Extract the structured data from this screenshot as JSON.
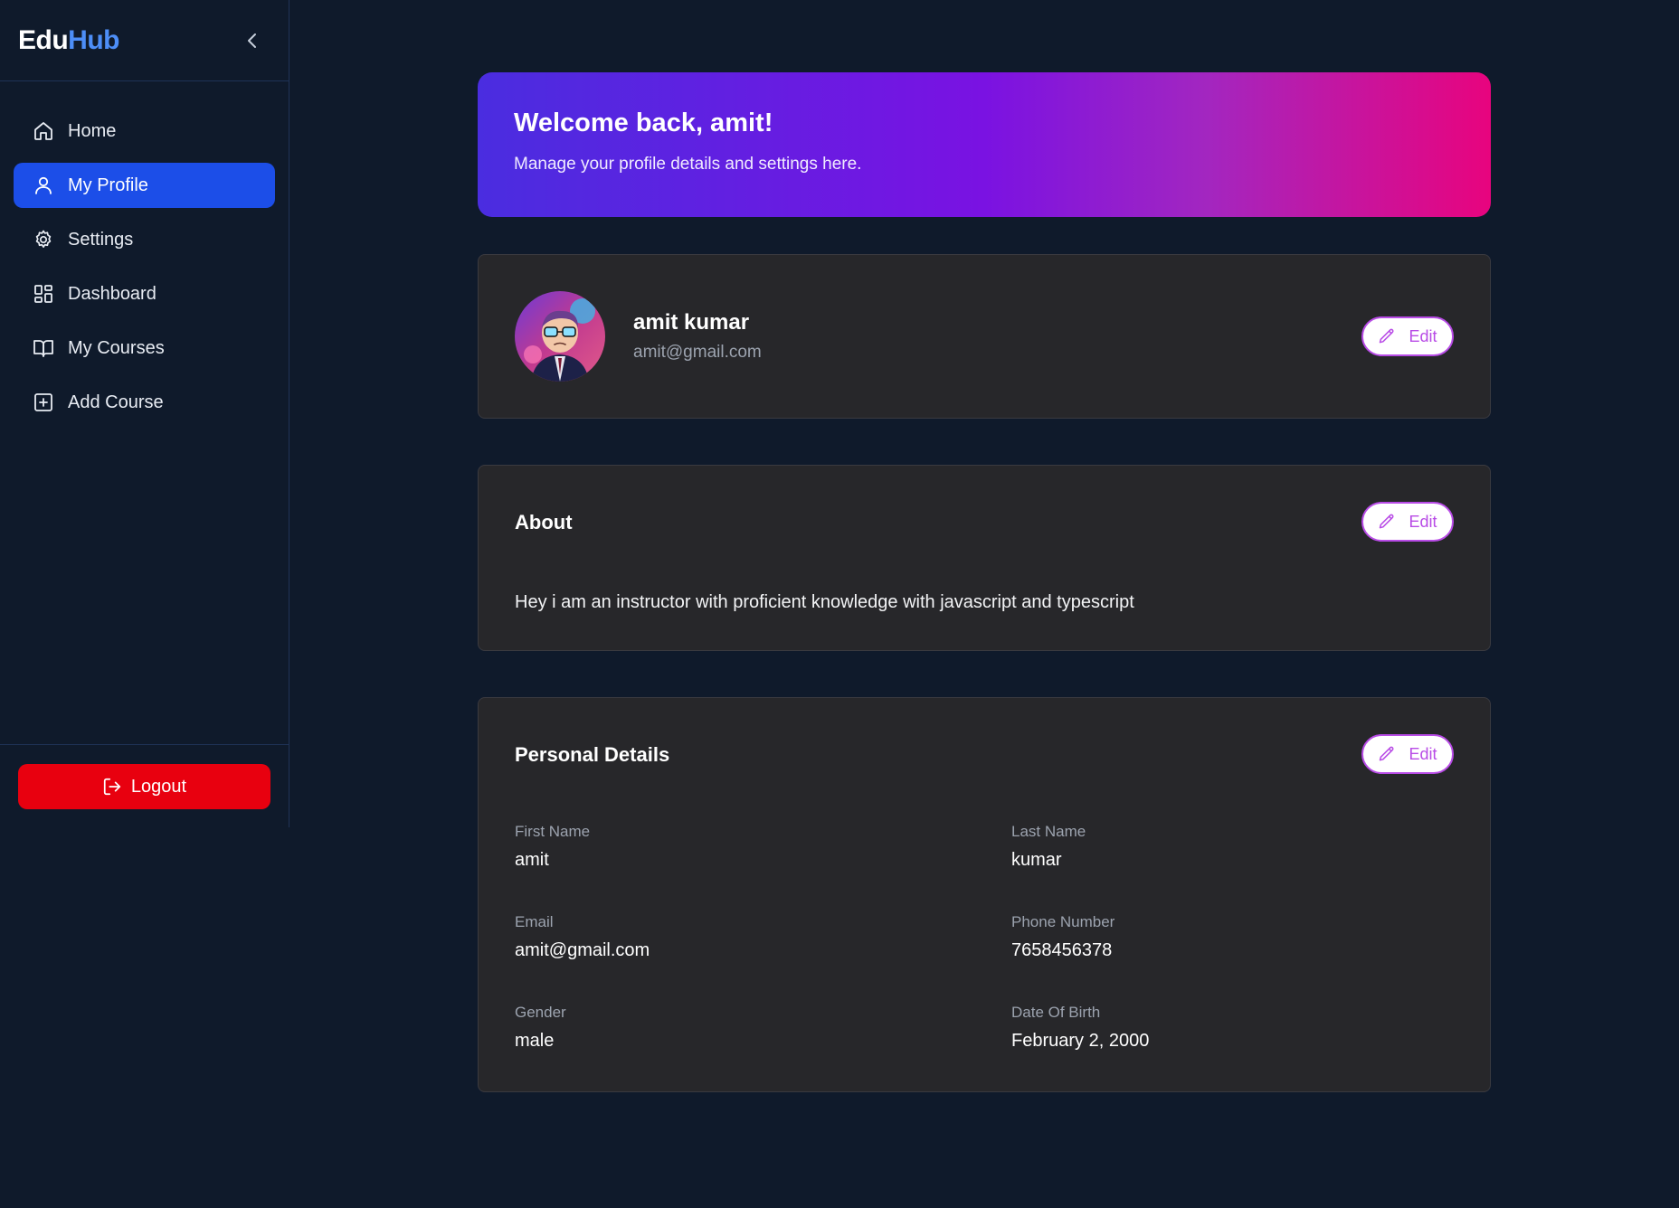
{
  "sidebar": {
    "logo_part1": "Edu",
    "logo_part2": "Hub",
    "items": [
      {
        "label": "Home",
        "icon": "home-icon",
        "active": false
      },
      {
        "label": "My Profile",
        "icon": "user-icon",
        "active": true
      },
      {
        "label": "Settings",
        "icon": "gear-icon",
        "active": false
      },
      {
        "label": "Dashboard",
        "icon": "dashboard-icon",
        "active": false
      },
      {
        "label": "My Courses",
        "icon": "book-icon",
        "active": false
      },
      {
        "label": "Add Course",
        "icon": "plus-square-icon",
        "active": false
      }
    ],
    "logout_label": "Logout"
  },
  "banner": {
    "title": "Welcome back, amit!",
    "subtitle": "Manage your profile details and settings here."
  },
  "profile": {
    "name": "amit kumar",
    "email": "amit@gmail.com",
    "edit_label": "Edit"
  },
  "about": {
    "title": "About",
    "text": "Hey i am an instructor with proficient knowledge with javascript and typescript",
    "edit_label": "Edit"
  },
  "personal_details": {
    "title": "Personal Details",
    "edit_label": "Edit",
    "fields": [
      {
        "label": "First Name",
        "value": "amit"
      },
      {
        "label": "Last Name",
        "value": "kumar"
      },
      {
        "label": "Email",
        "value": "amit@gmail.com"
      },
      {
        "label": "Phone Number",
        "value": "7658456378"
      },
      {
        "label": "Gender",
        "value": "male"
      },
      {
        "label": "Date Of Birth",
        "value": "February 2, 2000"
      }
    ]
  },
  "colors": {
    "background": "#0f1a2b",
    "active_nav": "#1c4ee8",
    "logout": "#e8000f",
    "card": "#27272a",
    "edit_accent": "#b84be6",
    "logo_accent": "#4d8ef7"
  }
}
